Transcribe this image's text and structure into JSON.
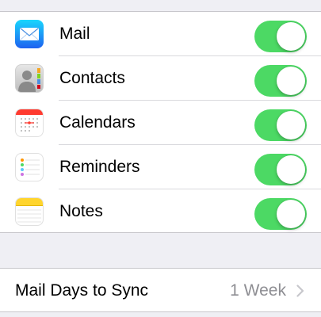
{
  "accounts_sync": {
    "items": [
      {
        "label": "Mail",
        "icon": "mail-icon",
        "enabled": true
      },
      {
        "label": "Contacts",
        "icon": "contacts-icon",
        "enabled": true
      },
      {
        "label": "Calendars",
        "icon": "calendar-icon",
        "enabled": true
      },
      {
        "label": "Reminders",
        "icon": "reminders-icon",
        "enabled": true
      },
      {
        "label": "Notes",
        "icon": "notes-icon",
        "enabled": true
      }
    ],
    "switch_on_color": "#4cd964"
  },
  "mail_days": {
    "label": "Mail Days to Sync",
    "value": "1 Week",
    "chevron_icon": "chevron-right-icon"
  },
  "colors": {
    "background": "#efeff4",
    "secondary_text": "#8e8e93"
  }
}
